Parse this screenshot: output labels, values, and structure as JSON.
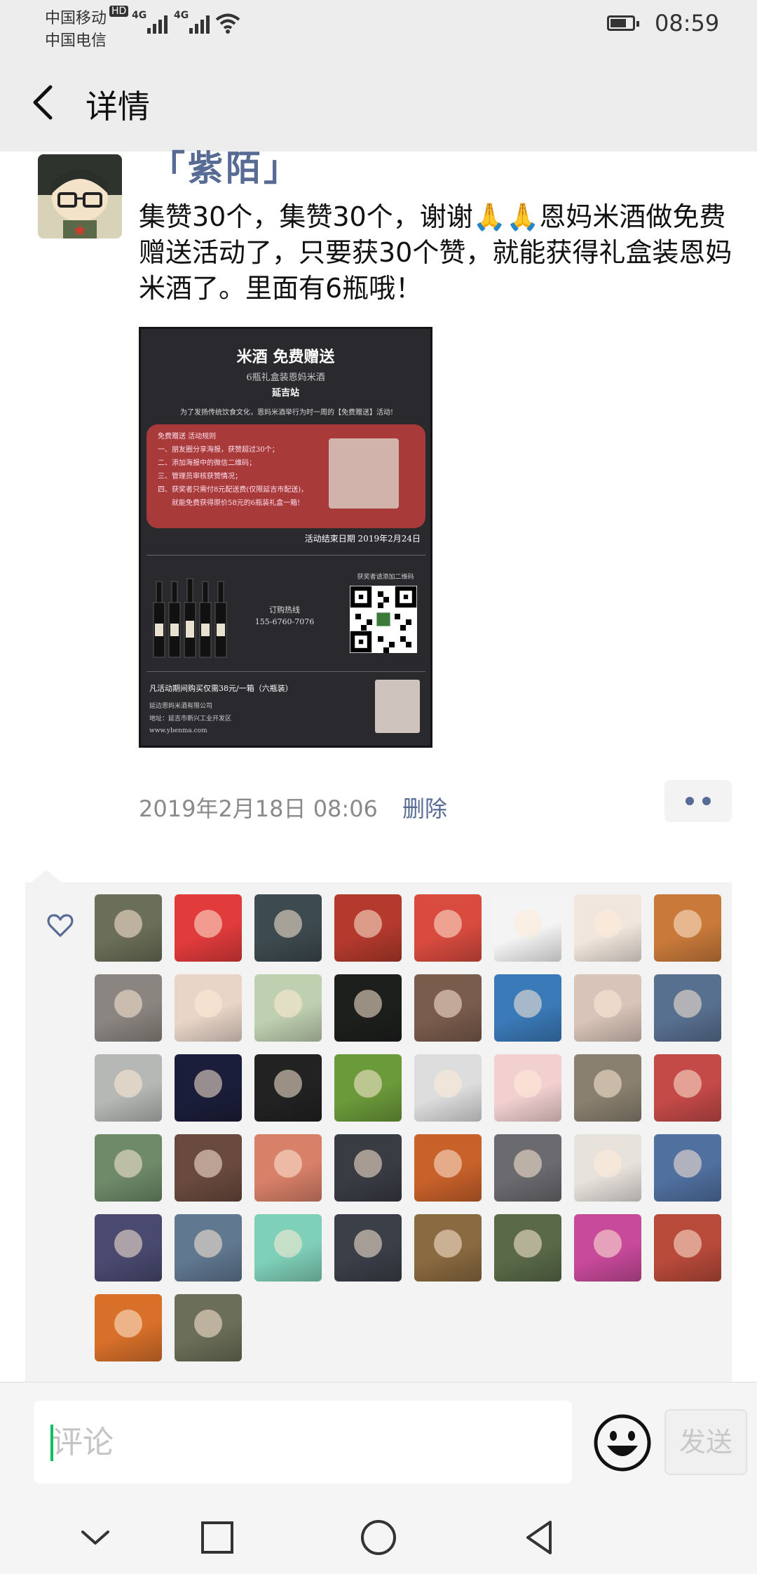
{
  "status_bar": {
    "carrier1": "中国移动",
    "hd": "HD",
    "carrier2": "中国电信",
    "network1": "4G",
    "network2": "4G",
    "time": "08:59",
    "icons": [
      "signal-icon",
      "wifi-icon",
      "battery-icon"
    ]
  },
  "header": {
    "back_icon": "chevron-left-icon",
    "title": "详情"
  },
  "post": {
    "author": "「紫陌」",
    "text": "集赞30个，集赞30个，谢谢🙏🙏恩妈米酒做免费赠送活动了，只要获30个赞，就能获得礼盒装恩妈米酒了。里面有6瓶哦！",
    "poster": {
      "title": "米酒 免费赠送",
      "subtitle": "6瓶礼盒装恩妈米酒",
      "site": "延吉站",
      "intro": "为了发扬传统饮食文化，恩妈米酒举行为时一周的【免费赠送】活动!",
      "rules": "免费赠送 活动规则\n一、朋友圈分享海报，获赞超过30个；\n二、添加海报中的微信二维码；\n三、管理员审核获赞情况；\n四、获奖者只需付8元配送费(仅限延吉市配送)，\n　　就能免费获得原价58元的6瓶装礼盒一箱!",
      "end_date": "活动结束日期 2019年2月24日",
      "hotline_label": "订购热线",
      "hotline": "155-6760-7076",
      "qr_caption": "获奖者请添加二维码",
      "price_note": "凡活动期间购买仅需38元/一箱（六瓶装）",
      "company": "延边恩妈米酒有限公司",
      "address": "地址：延吉市新兴工业开发区",
      "website": "www.ybenma.com"
    },
    "time": "2019年2月18日 08:06",
    "delete_label": "删除",
    "more_icon": "more-dots-icon"
  },
  "likes": {
    "icon": "heart-icon",
    "count": 42,
    "avatar_colors": [
      "#6b6e58",
      "#e23b3b",
      "#3d4a4f",
      "#b43a2d",
      "#d94b3e",
      "#f4f4f4",
      "#f1e6dd",
      "#c97a3a",
      "#8a8580",
      "#e8d5c8",
      "#bfd0b0",
      "#1d1f1d",
      "#7a5c4c",
      "#3a7ab8",
      "#d8c4b8",
      "#587090",
      "#b5b8b5",
      "#1b1e3a",
      "#222222",
      "#6b9a3a",
      "#dddddd",
      "#f2d0d0",
      "#8a8070",
      "#c44a48",
      "#6e8a68",
      "#6a4a3e",
      "#d88068",
      "#3a3c44",
      "#c8612a",
      "#6b6a6e",
      "#e8e2dc",
      "#5070a0",
      "#4a4a70",
      "#607890",
      "#7fd0b8",
      "#3a3f48",
      "#8a6a40",
      "#5a6a48",
      "#c84a9a",
      "#b84a3a",
      "#d8702a",
      "#6b6e58"
    ]
  },
  "comment": {
    "placeholder": "评论",
    "emoji_icon": "smiley-icon",
    "send_label": "发送"
  },
  "nav": {
    "icons": [
      "nav-down-icon",
      "nav-recents-icon",
      "nav-home-icon",
      "nav-back-icon"
    ]
  }
}
